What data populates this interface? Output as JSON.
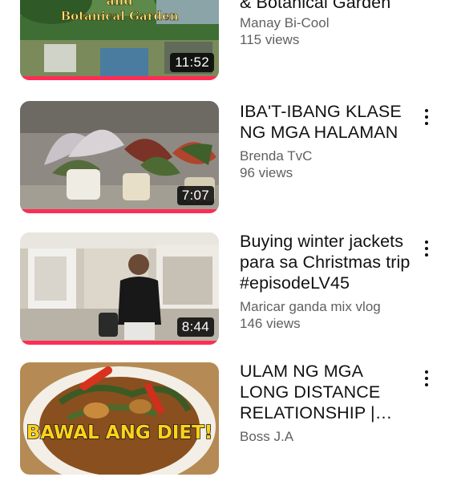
{
  "videos": [
    {
      "title": "& Botanical Garden",
      "channel": "Manay Bi-Cool",
      "views": "115 views",
      "duration": "11:52",
      "thumb_text": [
        "and",
        "Botanical Garden"
      ],
      "watched": 1.0
    },
    {
      "title": "IBA'T-IBANG KLASE NG MGA HALAMAN",
      "channel": "Brenda TvC",
      "views": "96 views",
      "duration": "7:07",
      "watched": 1.0
    },
    {
      "title": "Buying winter jackets para sa Christmas trip #episodeLV45",
      "channel": "Maricar ganda mix vlog",
      "views": "146 views",
      "duration": "8:44",
      "watched": 1.0
    },
    {
      "title": "ULAM NG MGA LONG DISTANCE RELATIONSHIP | AD...",
      "channel": "Boss J.A",
      "views": "",
      "thumb_text": "BAWAL ANG DIET!"
    }
  ],
  "colors": {
    "progress": "#ff2d55",
    "text_primary": "#111111",
    "text_secondary": "#606060"
  },
  "icons": {
    "more": "more-vert-icon"
  }
}
